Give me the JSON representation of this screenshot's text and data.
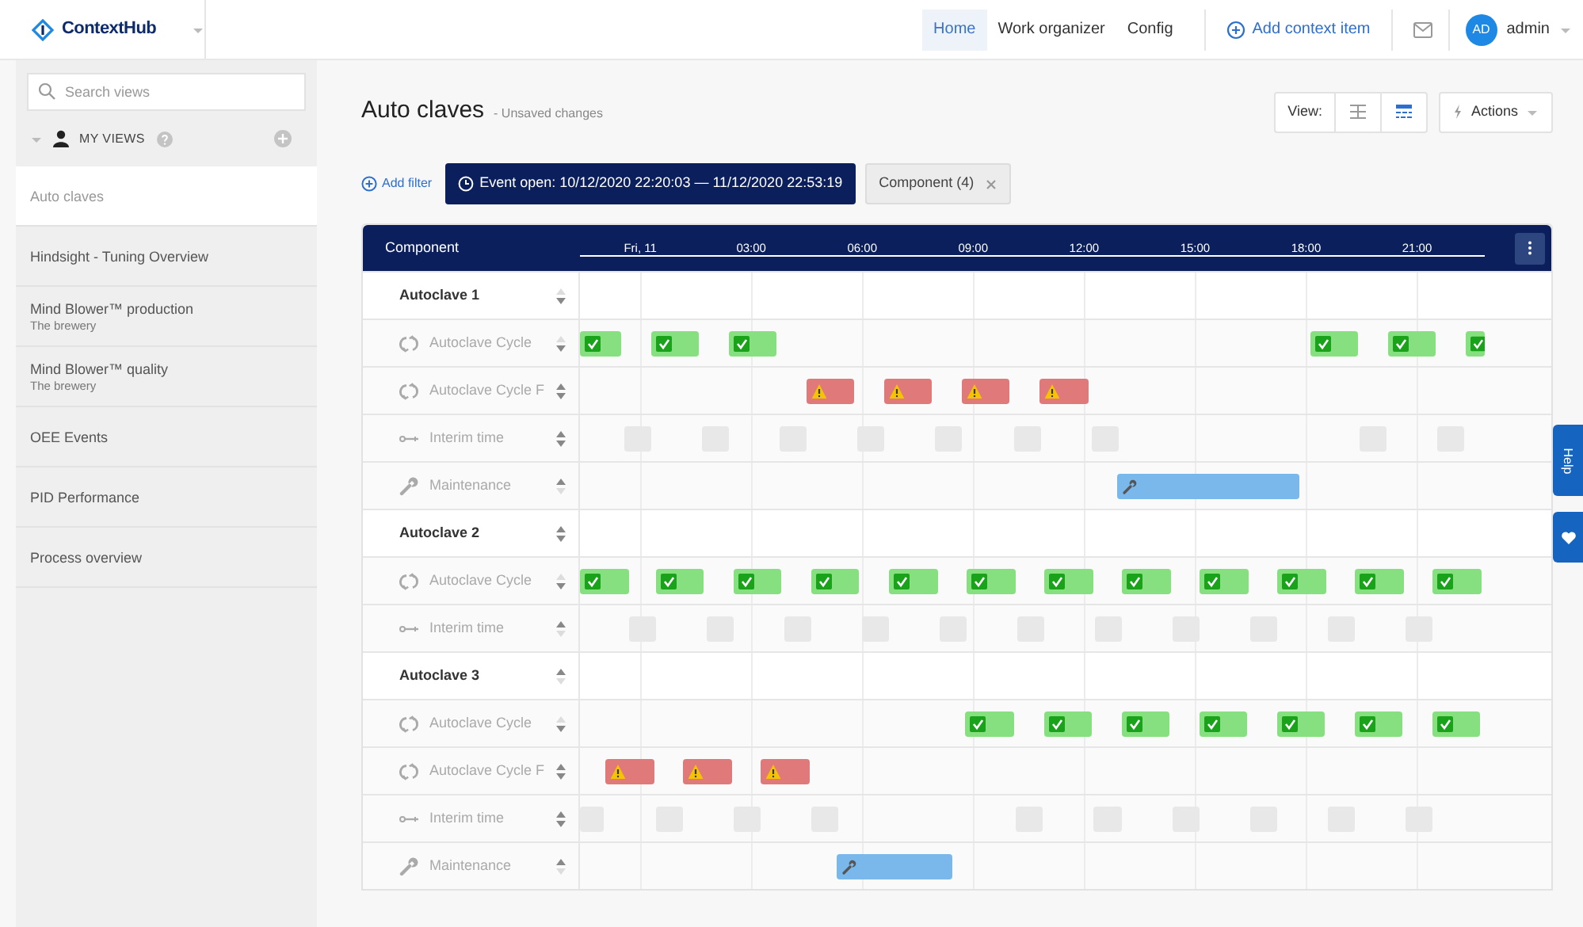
{
  "app": {
    "name": "ContextHub"
  },
  "nav": [
    {
      "label": "Home",
      "selected": true
    },
    {
      "label": "Work organizer",
      "selected": false
    },
    {
      "label": "Config",
      "selected": false
    }
  ],
  "add_item": "Add context item",
  "user": {
    "initials": "AD",
    "name": "admin"
  },
  "sidebar": {
    "search_placeholder": "Search views",
    "section": "MY VIEWS",
    "items": [
      {
        "title": "Auto claves",
        "selected": true
      },
      {
        "title": "Hindsight - Tuning Overview",
        "selected": false
      },
      {
        "title": "Mind Blower™ production",
        "subtitle": "The brewery",
        "selected": false
      },
      {
        "title": "Mind Blower™ quality",
        "subtitle": "The brewery",
        "selected": false
      },
      {
        "title": "OEE Events",
        "selected": false
      },
      {
        "title": "PID Performance",
        "selected": false
      },
      {
        "title": "Process overview",
        "selected": false
      }
    ]
  },
  "page": {
    "title": "Auto claves",
    "note": "- Unsaved changes",
    "view_label": "View:",
    "views": [
      {
        "kind": "table",
        "selected": false
      },
      {
        "kind": "timeline",
        "selected": true
      }
    ],
    "actions": "Actions"
  },
  "filters": {
    "add": "Add filter",
    "chips": [
      {
        "kind": "time",
        "label": "Event open: 10/12/2020 22:20:03 — 11/12/2020 22:53:19"
      },
      {
        "kind": "component",
        "label": "Component (4)"
      }
    ]
  },
  "timeline": {
    "column": "Component",
    "ticks": [
      "Fri, 11",
      "03:00",
      "06:00",
      "09:00",
      "12:00",
      "15:00",
      "18:00",
      "21:00"
    ],
    "rows": [
      {
        "kind": "group",
        "label": "Autoclave 1",
        "up_disabled": true,
        "down_disabled": false,
        "events": []
      },
      {
        "kind": "cycle",
        "label": "Autoclave Cycle",
        "up_disabled": true,
        "down_disabled": false,
        "events": [
          {
            "kind": "ok"
          },
          {
            "kind": "ok"
          },
          {
            "kind": "ok"
          },
          {
            "kind": "ok"
          },
          {
            "kind": "ok"
          },
          {
            "kind": "ok"
          }
        ]
      },
      {
        "kind": "cycle",
        "label": "Autoclave Cycle F",
        "up_disabled": false,
        "down_disabled": false,
        "events": [
          {
            "kind": "fail"
          },
          {
            "kind": "fail"
          },
          {
            "kind": "fail"
          },
          {
            "kind": "fail"
          }
        ]
      },
      {
        "kind": "interim",
        "label": "Interim time",
        "up_disabled": false,
        "down_disabled": false,
        "events": [
          {
            "kind": "gap"
          },
          {
            "kind": "gap"
          },
          {
            "kind": "gap"
          },
          {
            "kind": "gap"
          },
          {
            "kind": "gap"
          },
          {
            "kind": "gap"
          },
          {
            "kind": "gap"
          },
          {
            "kind": "gap"
          },
          {
            "kind": "gap"
          }
        ]
      },
      {
        "kind": "maintenance",
        "label": "Maintenance",
        "up_disabled": false,
        "down_disabled": true,
        "events": [
          {
            "kind": "service"
          }
        ]
      },
      {
        "kind": "group",
        "label": "Autoclave 2",
        "up_disabled": false,
        "down_disabled": false,
        "events": []
      },
      {
        "kind": "cycle",
        "label": "Autoclave Cycle",
        "up_disabled": true,
        "down_disabled": false,
        "events": [
          {
            "kind": "ok"
          },
          {
            "kind": "ok"
          },
          {
            "kind": "ok"
          },
          {
            "kind": "ok"
          },
          {
            "kind": "ok"
          },
          {
            "kind": "ok"
          },
          {
            "kind": "ok"
          },
          {
            "kind": "ok"
          },
          {
            "kind": "ok"
          },
          {
            "kind": "ok"
          },
          {
            "kind": "ok"
          },
          {
            "kind": "ok"
          }
        ]
      },
      {
        "kind": "interim",
        "label": "Interim time",
        "up_disabled": false,
        "down_disabled": true,
        "events": [
          {
            "kind": "gap"
          },
          {
            "kind": "gap"
          },
          {
            "kind": "gap"
          },
          {
            "kind": "gap"
          },
          {
            "kind": "gap"
          },
          {
            "kind": "gap"
          },
          {
            "kind": "gap"
          },
          {
            "kind": "gap"
          },
          {
            "kind": "gap"
          },
          {
            "kind": "gap"
          },
          {
            "kind": "gap"
          }
        ]
      },
      {
        "kind": "group",
        "label": "Autoclave 3",
        "up_disabled": false,
        "down_disabled": true,
        "events": []
      },
      {
        "kind": "cycle",
        "label": "Autoclave Cycle",
        "up_disabled": true,
        "down_disabled": false,
        "events": [
          {
            "kind": "ok"
          },
          {
            "kind": "ok"
          },
          {
            "kind": "ok"
          },
          {
            "kind": "ok"
          },
          {
            "kind": "ok"
          },
          {
            "kind": "ok"
          },
          {
            "kind": "ok"
          }
        ]
      },
      {
        "kind": "cycle",
        "label": "Autoclave Cycle F",
        "up_disabled": false,
        "down_disabled": false,
        "events": [
          {
            "kind": "fail"
          },
          {
            "kind": "fail"
          },
          {
            "kind": "fail"
          }
        ]
      },
      {
        "kind": "interim",
        "label": "Interim time",
        "up_disabled": false,
        "down_disabled": false,
        "events": [
          {
            "kind": "gap"
          },
          {
            "kind": "gap"
          },
          {
            "kind": "gap"
          },
          {
            "kind": "gap"
          },
          {
            "kind": "gap"
          },
          {
            "kind": "gap"
          },
          {
            "kind": "gap"
          },
          {
            "kind": "gap"
          },
          {
            "kind": "gap"
          },
          {
            "kind": "gap"
          }
        ]
      },
      {
        "kind": "maintenance",
        "label": "Maintenance",
        "up_disabled": false,
        "down_disabled": true,
        "events": [
          {
            "kind": "service"
          }
        ]
      }
    ]
  },
  "side_tabs": [
    {
      "kind": "help",
      "label": "Help"
    },
    {
      "kind": "feedback"
    }
  ]
}
